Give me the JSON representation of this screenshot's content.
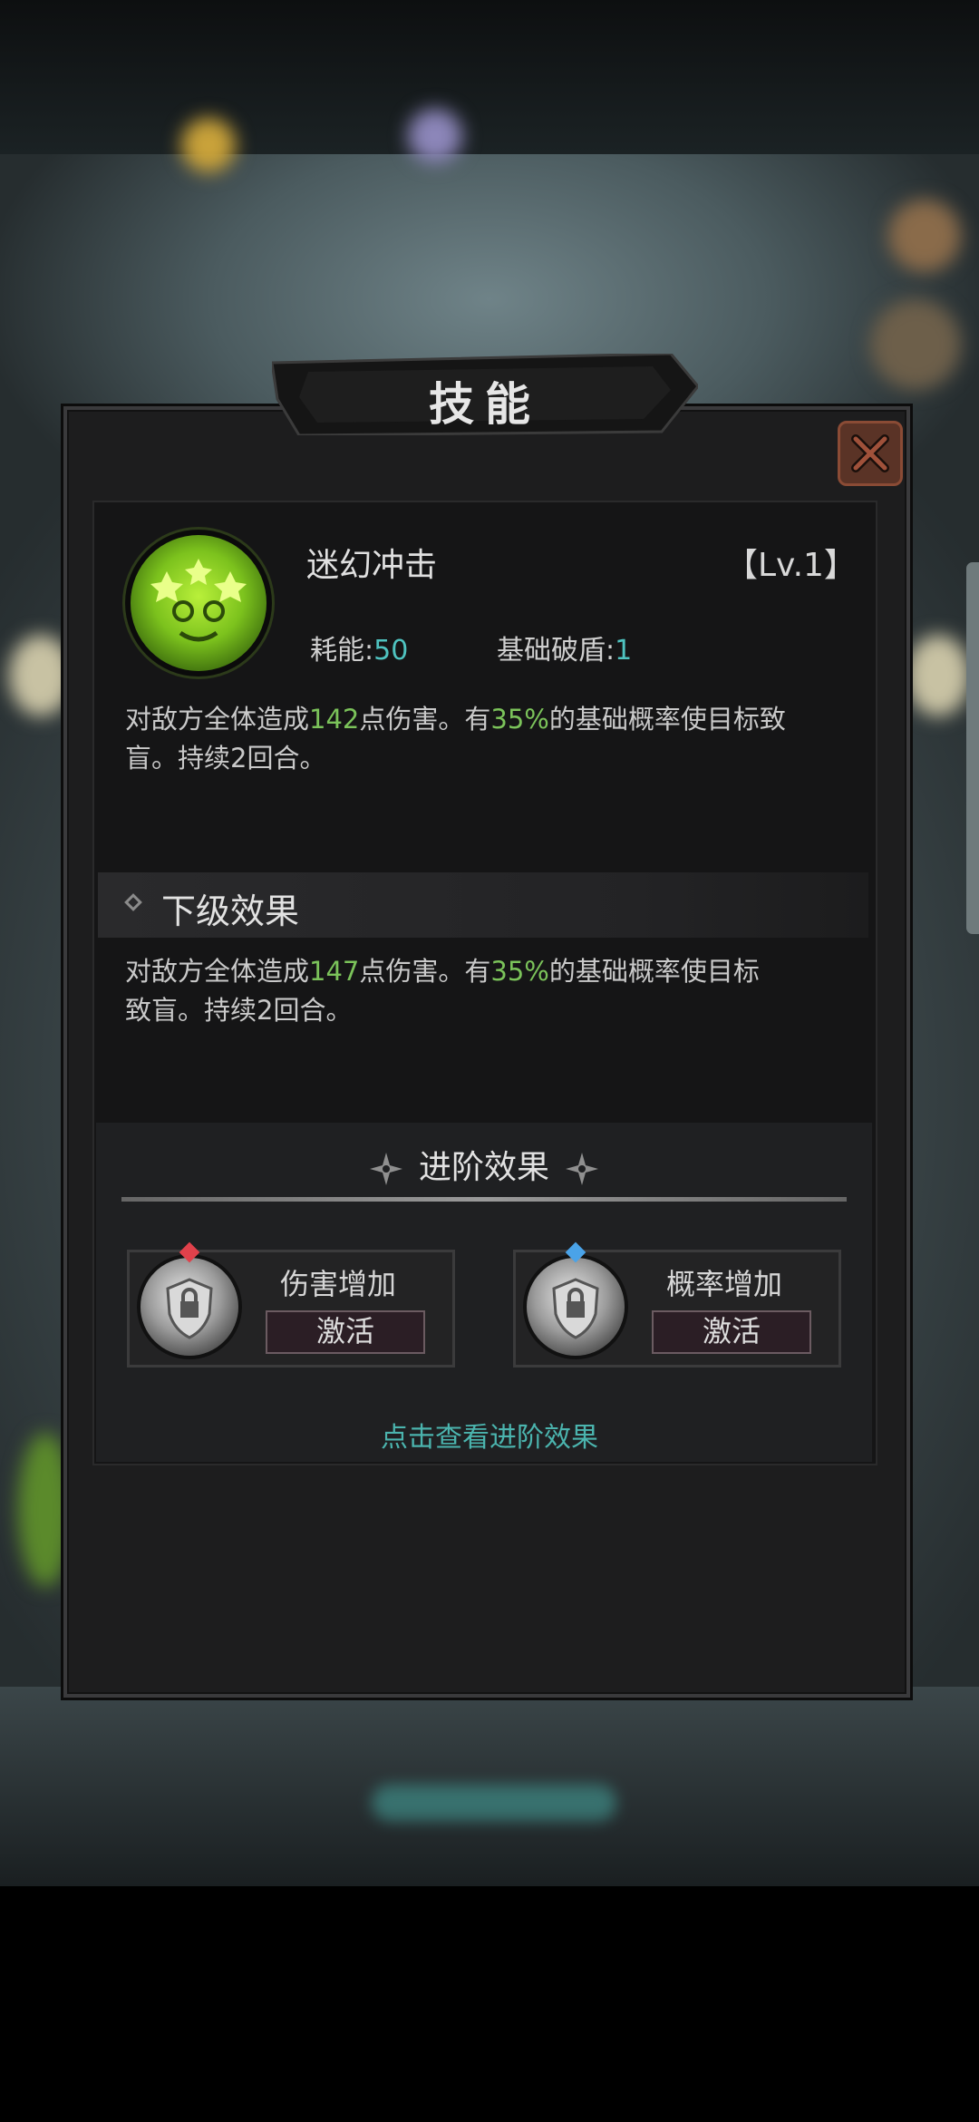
{
  "dialog": {
    "title": "技能",
    "close_icon": "close-x-icon"
  },
  "skill": {
    "name": "迷幻冲击",
    "level": "【Lv.1】",
    "icon": "psychedelic-face-icon",
    "cost_label": "耗能:",
    "cost_value": "50",
    "shield_label": "基础破盾:",
    "shield_value": "1",
    "desc_lines": [
      [
        "对敌方全体造成",
        "142",
        "点伤害。有",
        "35%",
        "的基础概率使目标致"
      ],
      [
        "盲。持续2回合。"
      ]
    ]
  },
  "next_level": {
    "title": "下级效果",
    "desc_lines": [
      [
        "对敌方全体造成",
        "147",
        "点伤害。有",
        "35%",
        "的基础概率使目标"
      ],
      [
        "致盲。持续2回合。"
      ]
    ]
  },
  "advanced": {
    "title": "进阶效果",
    "cards": [
      {
        "label": "伤害增加",
        "button": "激活",
        "gem_color": "#e0414b"
      },
      {
        "label": "概率增加",
        "button": "激活",
        "gem_color": "#4aa3e8"
      }
    ],
    "view_link": "点击查看进阶效果"
  },
  "colors": {
    "highlight_green": "#7bc35a",
    "highlight_teal": "#4fc3c0",
    "link": "#4bb4ae"
  }
}
